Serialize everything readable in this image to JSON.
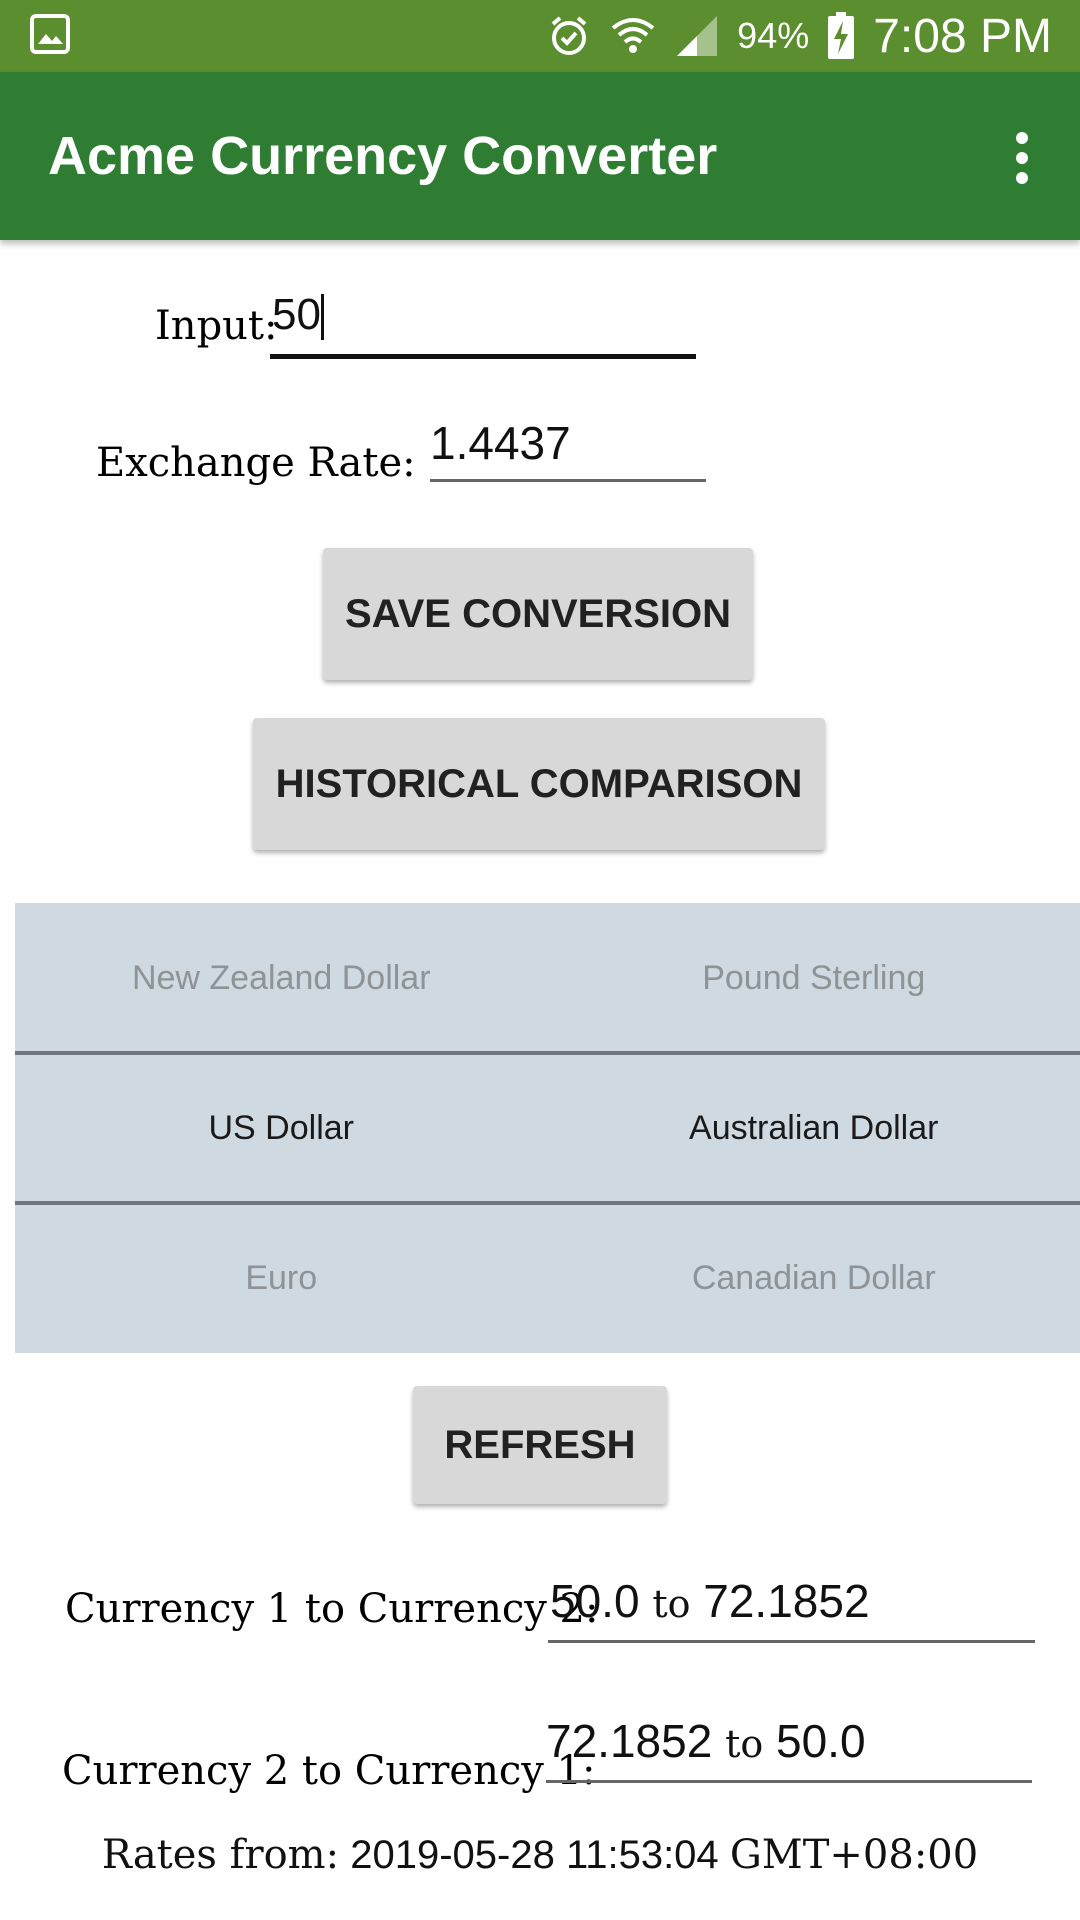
{
  "status_bar": {
    "battery_percent": "94%",
    "time": "7:08 PM",
    "icons": [
      "gallery-icon",
      "alarm-icon",
      "wifi-icon",
      "cell-signal-icon",
      "battery-charging-icon"
    ]
  },
  "app_bar": {
    "title": "Acme Currency Converter",
    "menu_icon": "overflow-menu-icon"
  },
  "form": {
    "input_label": "Input:",
    "input_value": "50",
    "rate_label": "Exchange Rate:",
    "rate_value": "1.4437"
  },
  "buttons": {
    "save": "SAVE CONVERSION",
    "historical": "HISTORICAL COMPARISON",
    "refresh": "REFRESH"
  },
  "picker": {
    "rows": [
      {
        "left": "New Zealand Dollar",
        "right": "Pound Sterling"
      },
      {
        "left": "US Dollar",
        "right": "Australian Dollar"
      },
      {
        "left": "Euro",
        "right": "Canadian Dollar"
      }
    ]
  },
  "results": {
    "c1_to_c2_label": "Currency 1 to Currency 2:",
    "c1_to_c2_from": "50.0",
    "c1_to_c2_to": "72.1852",
    "c2_to_c1_label": "Currency 2 to Currency 1:",
    "c2_to_c1_from": "72.1852",
    "c2_to_c1_to": "50.0",
    "to_word": "to"
  },
  "footer": {
    "rates_label": "Rates from:",
    "rates_date": "2019-05-28 11:53:04",
    "rates_tz": "GMT+08:00"
  },
  "colors": {
    "status_bar": "#5b8e2e",
    "app_bar": "#2e7d32",
    "picker_bg": "#cfd9e2",
    "button_bg": "#d8d8d8"
  }
}
